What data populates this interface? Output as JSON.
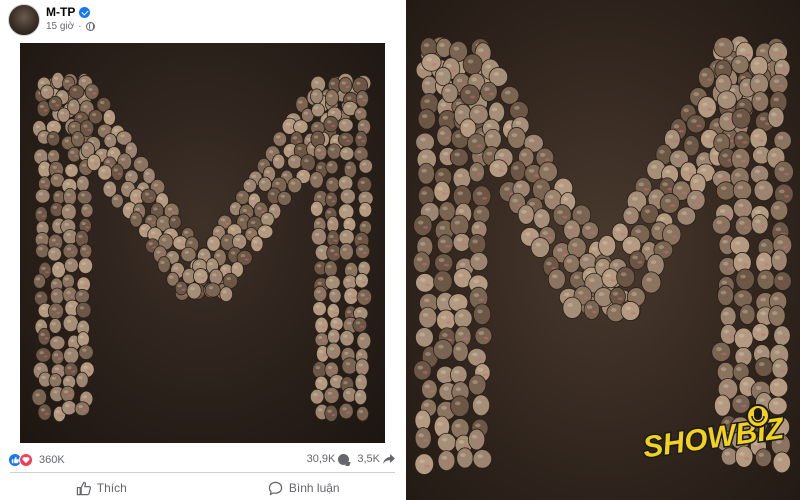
{
  "post": {
    "author": "M-TP",
    "time": "15 giờ",
    "reactions_count": "360K",
    "comments_count": "30,9K",
    "shares_count": "3,5K",
    "actions": {
      "like_label": "Thích",
      "comment_label": "Bình luận"
    }
  },
  "artwork": {
    "description_icon": "letter-m-mosaic",
    "colors": {
      "background": "#2b211b",
      "figure": "#8a7460"
    }
  },
  "watermark": {
    "text": "SHOWBIZ",
    "colors": {
      "fill": "#f3d21a",
      "outline": "#1a1a1a"
    }
  },
  "colors": {
    "facebook_blue": "#1877f2",
    "love_red": "#f33e58",
    "secondary_text": "#65676b"
  }
}
